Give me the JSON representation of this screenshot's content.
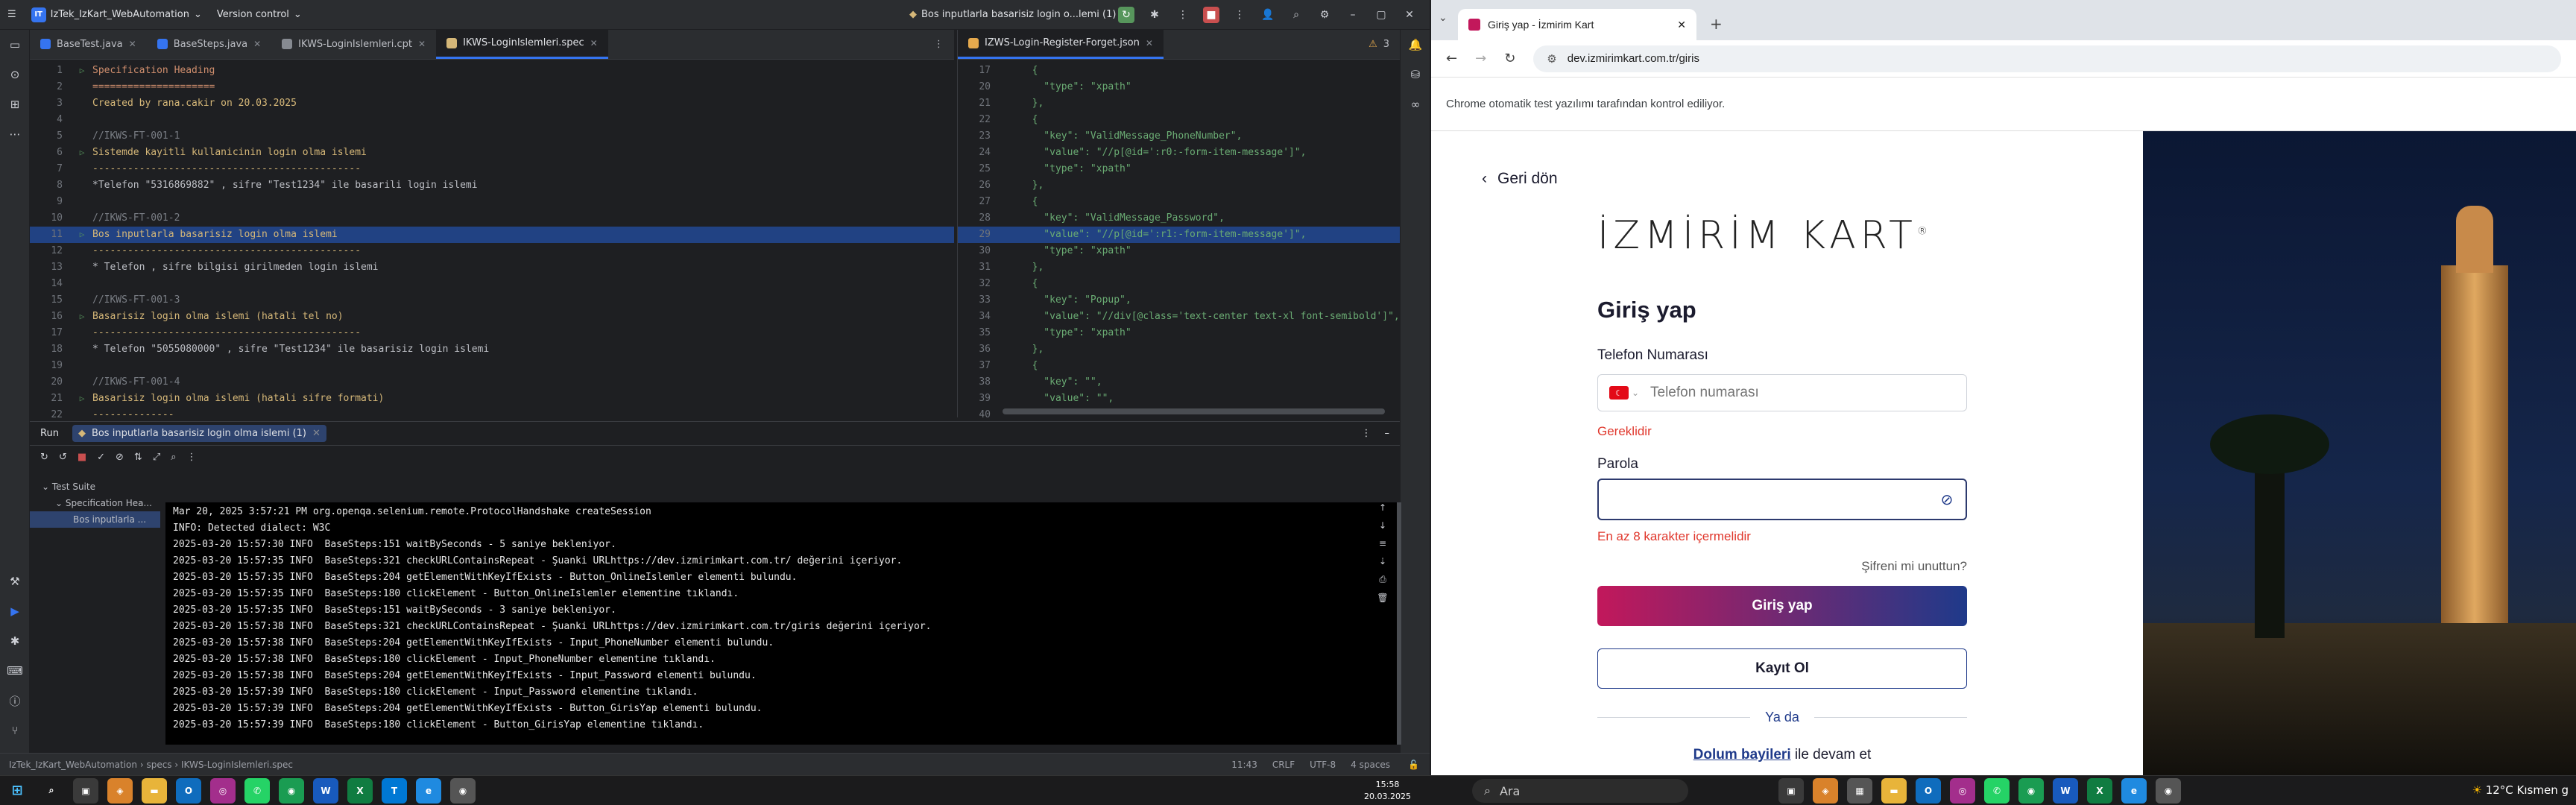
{
  "ide": {
    "project_badge": "IT",
    "project_name": "IzTek_IzKart_WebAutomation",
    "vcs": "Version control",
    "run_config": "Bos inputlarla basarisiz login o...lemi (1)",
    "editor_tabs": [
      "BaseTest.java",
      "BaseSteps.java",
      "IKWS-LoginIslemleri.cpt",
      "IKWS-LoginIslemleri.spec"
    ],
    "right_tab": "IZWS-Login-Register-Forget.json",
    "inspection_count": "3",
    "spec_lines": [
      {
        "n": "1",
        "cls": "c-hdr",
        "t": "Specification Heading",
        "g": "run"
      },
      {
        "n": "2",
        "cls": "c-hdr",
        "t": "=====================",
        "g": ""
      },
      {
        "n": "3",
        "cls": "c-sc",
        "t": "Created by rana.cakir on 20.03.2025",
        "g": ""
      },
      {
        "n": "4",
        "cls": "c-def",
        "t": "",
        "g": ""
      },
      {
        "n": "5",
        "cls": "c-com",
        "t": "//IKWS-FT-001-1",
        "g": ""
      },
      {
        "n": "6",
        "cls": "c-sc",
        "t": "Sistemde kayitli kullanicinin login olma islemi",
        "g": "run"
      },
      {
        "n": "7",
        "cls": "c-sc",
        "t": "----------------------------------------------",
        "g": ""
      },
      {
        "n": "8",
        "cls": "c-def",
        "t": "*Telefon \"5316869882\" , sifre \"Test1234\" ile basarili login islemi",
        "g": ""
      },
      {
        "n": "9",
        "cls": "c-def",
        "t": "",
        "g": ""
      },
      {
        "n": "10",
        "cls": "c-com",
        "t": "//IKWS-FT-001-2",
        "g": ""
      },
      {
        "n": "11",
        "cls": "c-sc",
        "t": "Bos inputlarla basarisiz login olma islemi",
        "g": "run",
        "hl": true
      },
      {
        "n": "12",
        "cls": "c-sc",
        "t": "----------------------------------------------",
        "g": ""
      },
      {
        "n": "13",
        "cls": "c-def",
        "t": "* Telefon , sifre bilgisi girilmeden login islemi",
        "g": ""
      },
      {
        "n": "14",
        "cls": "c-def",
        "t": "",
        "g": ""
      },
      {
        "n": "15",
        "cls": "c-com",
        "t": "//IKWS-FT-001-3",
        "g": ""
      },
      {
        "n": "16",
        "cls": "c-sc",
        "t": "Basarisiz login olma islemi (hatali tel no)",
        "g": "run"
      },
      {
        "n": "17",
        "cls": "c-sc",
        "t": "----------------------------------------------",
        "g": ""
      },
      {
        "n": "18",
        "cls": "c-def",
        "t": "* Telefon \"5055080000\" , sifre \"Test1234\" ile basarisiz login islemi",
        "g": ""
      },
      {
        "n": "19",
        "cls": "c-def",
        "t": "",
        "g": ""
      },
      {
        "n": "20",
        "cls": "c-com",
        "t": "//IKWS-FT-001-4",
        "g": ""
      },
      {
        "n": "21",
        "cls": "c-sc",
        "t": "Basarisiz login olma islemi (hatali sifre formati)",
        "g": "run"
      },
      {
        "n": "22",
        "cls": "c-sc",
        "t": "--------------",
        "g": ""
      }
    ],
    "json_lines": [
      {
        "n": "17",
        "t": "  {"
      },
      {
        "n": "20",
        "t": "    \"type\": \"xpath\""
      },
      {
        "n": "21",
        "t": "  },"
      },
      {
        "n": "22",
        "t": "  {"
      },
      {
        "n": "23",
        "t": "    \"key\": \"ValidMessage_PhoneNumber\","
      },
      {
        "n": "24",
        "t": "    \"value\": \"//p[@id=':r0:-form-item-message']\","
      },
      {
        "n": "25",
        "t": "    \"type\": \"xpath\""
      },
      {
        "n": "26",
        "t": "  },"
      },
      {
        "n": "27",
        "t": "  {"
      },
      {
        "n": "28",
        "t": "    \"key\": \"ValidMessage_Password\","
      },
      {
        "n": "29",
        "t": "    \"value\": \"//p[@id=':r1:-form-item-message']\",",
        "hl": true
      },
      {
        "n": "30",
        "t": "    \"type\": \"xpath\""
      },
      {
        "n": "31",
        "t": "  },"
      },
      {
        "n": "32",
        "t": "  {"
      },
      {
        "n": "33",
        "t": "    \"key\": \"Popup\","
      },
      {
        "n": "34",
        "t": "    \"value\": \"//div[@class='text-center text-xl font-semibold']\","
      },
      {
        "n": "35",
        "t": "    \"type\": \"xpath\""
      },
      {
        "n": "36",
        "t": "  },"
      },
      {
        "n": "37",
        "t": "  {"
      },
      {
        "n": "38",
        "t": "    \"key\": \"\","
      },
      {
        "n": "39",
        "t": "    \"value\": \"\","
      },
      {
        "n": "40",
        "t": ""
      }
    ],
    "run_label": "Run",
    "run_tab": "Bos inputlarla basarisiz login olma islemi (1)",
    "tree": [
      "Test Suite",
      "Specification Hea...",
      "Bos inputlarla ..."
    ],
    "console": [
      "Mar 20, 2025 3:57:21 PM org.openqa.selenium.remote.ProtocolHandshake createSession",
      "INFO: Detected dialect: W3C",
      "2025-03-20 15:57:30 INFO  BaseSteps:151 waitBySeconds - 5 saniye bekleniyor.",
      "2025-03-20 15:57:35 INFO  BaseSteps:321 checkURLContainsRepeat - Şuanki URLhttps://dev.izmirimkart.com.tr/ değerini içeriyor.",
      "2025-03-20 15:57:35 INFO  BaseSteps:204 getElementWithKeyIfExists - Button_OnlineIslemler elementi bulundu.",
      "2025-03-20 15:57:35 INFO  BaseSteps:180 clickElement - Button_OnlineIslemler elementine tıklandı.",
      "2025-03-20 15:57:35 INFO  BaseSteps:151 waitBySeconds - 3 saniye bekleniyor.",
      "2025-03-20 15:57:38 INFO  BaseSteps:321 checkURLContainsRepeat - Şuanki URLhttps://dev.izmirimkart.com.tr/giris değerini içeriyor.",
      "2025-03-20 15:57:38 INFO  BaseSteps:204 getElementWithKeyIfExists - Input_PhoneNumber elementi bulundu.",
      "2025-03-20 15:57:38 INFO  BaseSteps:180 clickElement - Input_PhoneNumber elementine tıklandı.",
      "2025-03-20 15:57:38 INFO  BaseSteps:204 getElementWithKeyIfExists - Input_Password elementi bulundu.",
      "2025-03-20 15:57:39 INFO  BaseSteps:180 clickElement - Input_Password elementine tıklandı.",
      "2025-03-20 15:57:39 INFO  BaseSteps:204 getElementWithKeyIfExists - Button_GirisYap elementi bulundu.",
      "2025-03-20 15:57:39 INFO  BaseSteps:180 clickElement - Button_GirisYap elementine tıklandı."
    ],
    "status": {
      "breadcrumb": [
        "IzTek_IzKart_WebAutomation",
        "specs",
        "IKWS-LoginIslemleri.spec"
      ],
      "position": "11:43",
      "line_sep": "CRLF",
      "encoding": "UTF-8",
      "indent": "4 spaces"
    }
  },
  "browser": {
    "tab_title": "Giriş yap - İzmirim Kart",
    "url": "dev.izmirimkart.com.tr/giris",
    "infobar": "Chrome otomatik test yazılımı tarafından kontrol ediliyor.",
    "page": {
      "back": "Geri dön",
      "logo": "İZMİRİM KART",
      "title": "Giriş yap",
      "phone_label": "Telefon Numarası",
      "phone_placeholder": "Telefon numarası",
      "phone_error": "Gereklidir",
      "password_label": "Parola",
      "password_error": "En az 8 karakter içermelidir",
      "forgot": "Şifreni mi unuttun?",
      "login_btn": "Giriş yap",
      "register_btn": "Kayıt Ol",
      "or": "Ya da",
      "dolum_link": "Dolum bayileri",
      "dolum_rest": " ile devam et"
    }
  },
  "taskbar": {
    "search": "Ara",
    "clock_time": "15:58",
    "clock_date": "20.03.2025",
    "weather": "12°C  Kısmen g"
  },
  "colors": {
    "accent": "#3574f0",
    "login_gradient_start": "#c2185b",
    "login_gradient_end": "#1f3a8a",
    "error": "#e0372c"
  }
}
